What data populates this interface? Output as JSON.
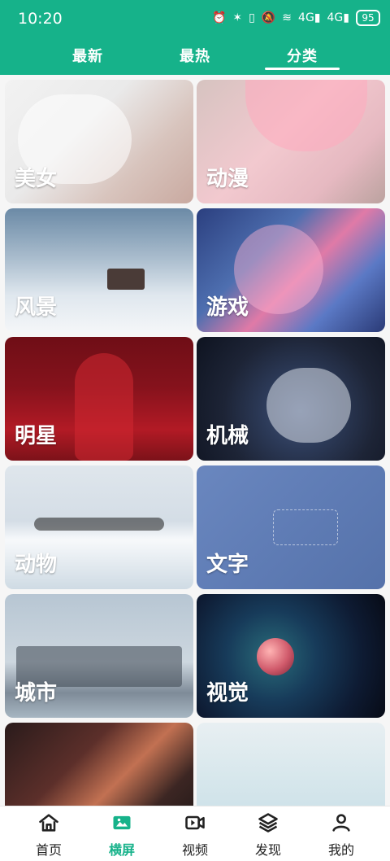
{
  "status_bar": {
    "time": "10:20",
    "icons": [
      "alarm-icon",
      "bluetooth-icon",
      "vibrate-icon",
      "mute-icon",
      "wifi-icon",
      "signal-4g-icon",
      "signal-4g-icon"
    ],
    "battery": "95",
    "net_label_1": "4G",
    "net_label_2": "4G"
  },
  "tabs": [
    {
      "label": "最新"
    },
    {
      "label": "最热"
    },
    {
      "label": "分类",
      "active": true
    }
  ],
  "categories": [
    {
      "label": "美女"
    },
    {
      "label": "动漫"
    },
    {
      "label": "风景"
    },
    {
      "label": "游戏"
    },
    {
      "label": "明星"
    },
    {
      "label": "机械"
    },
    {
      "label": "动物"
    },
    {
      "label": "文字"
    },
    {
      "label": "城市"
    },
    {
      "label": "视觉"
    },
    {
      "label": ""
    },
    {
      "label": ""
    }
  ],
  "bottom_nav": [
    {
      "label": "首页",
      "icon": "home-icon"
    },
    {
      "label": "横屏",
      "icon": "landscape-image-icon",
      "active": true
    },
    {
      "label": "视频",
      "icon": "video-icon"
    },
    {
      "label": "发现",
      "icon": "layers-icon"
    },
    {
      "label": "我的",
      "icon": "user-icon"
    }
  ],
  "colors": {
    "accent": "#16b28a",
    "nav_active": "#16b28a"
  }
}
